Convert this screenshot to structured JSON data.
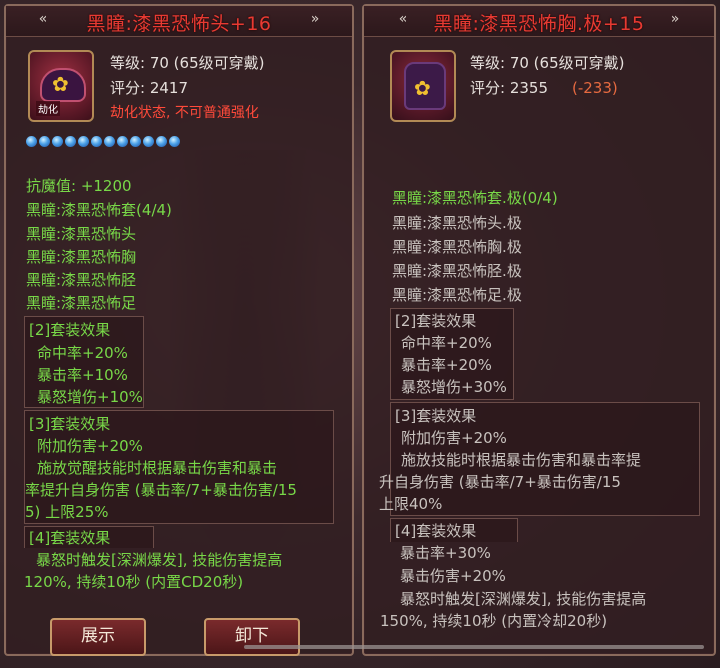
{
  "left": {
    "title": "黑瞳:漆黑恐怖头+16",
    "icon_badge": "劫化",
    "level": "等级: 70 (65级可穿戴)",
    "score": "评分: 2417",
    "status": "劫化状态, 不可普通强化",
    "gem_count": 12,
    "lines": [
      {
        "text": "抗魔值: +1200",
        "cls": "g"
      },
      {
        "text": "黑瞳:漆黑恐怖套(4/4)",
        "cls": "g"
      },
      {
        "text": "黑瞳:漆黑恐怖头",
        "cls": "g"
      },
      {
        "text": "黑瞳:漆黑恐怖胸",
        "cls": "g"
      },
      {
        "text": "黑瞳:漆黑恐怖胫",
        "cls": "g"
      },
      {
        "text": "黑瞳:漆黑恐怖足",
        "cls": "g"
      }
    ],
    "set2_header": "[2]套装效果",
    "set2": [
      "命中率+20%",
      "暴击率+10%",
      "暴怒增伤+10%"
    ],
    "set3_header": "[3]套装效果",
    "set3": [
      "附加伤害+20%",
      "施放觉醒技能时根据暴击伤害和暴击",
      "率提升自身伤害 (暴击率/7+暴击伤害/15",
      "5) 上限25%"
    ],
    "set4_header": "[4]套装效果",
    "set4": [
      "暴怒时触发[深渊爆发], 技能伤害提高",
      "120%, 持续10秒 (内置CD20秒)"
    ],
    "btn_show": "展示",
    "btn_unequip": "卸下"
  },
  "right": {
    "title": "黑瞳:漆黑恐怖胸.极+15",
    "level": "等级: 70 (65级可穿戴)",
    "score": "评分: 2355",
    "score_diff": "(-233)",
    "set_name": "黑瞳:漆黑恐怖套.极(0/4)",
    "set_items": [
      "黑瞳:漆黑恐怖头.极",
      "黑瞳:漆黑恐怖胸.极",
      "黑瞳:漆黑恐怖胫.极",
      "黑瞳:漆黑恐怖足.极"
    ],
    "set2_header": "[2]套装效果",
    "set2": [
      "命中率+20%",
      "暴击率+20%",
      "暴怒增伤+30%"
    ],
    "set3_header": "[3]套装效果",
    "set3": [
      "附加伤害+20%",
      "施放技能时根据暴击伤害和暴击率提",
      "升自身伤害 (暴击率/7+暴击伤害/15",
      "上限40%"
    ],
    "set4_header": "[4]套装效果",
    "set4": [
      "暴击率+30%",
      "暴击伤害+20%",
      "暴怒时触发[深渊爆发], 技能伤害提高",
      "150%, 持续10秒 (内置冷却20秒)"
    ]
  },
  "colors": {
    "title_red": "#e83a32",
    "effect_green": "#78d848",
    "inactive_gray": "#c8c2be",
    "diff_red": "#e66a40"
  }
}
